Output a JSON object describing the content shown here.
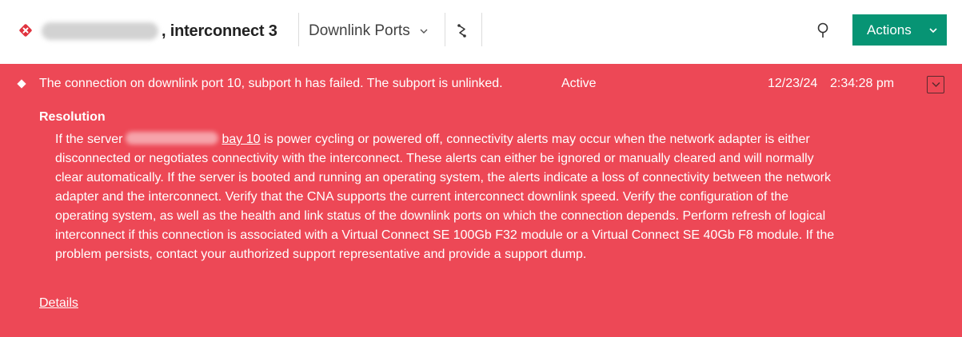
{
  "header": {
    "title": ", interconnect 3",
    "view_select_label": "Downlink Ports",
    "actions_label": "Actions",
    "status_color": "#e0323e",
    "accent_color": "#079474",
    "icons": [
      "critical-status-icon",
      "chevron-down-icon",
      "graph-icon",
      "search-icon"
    ]
  },
  "alert": {
    "message": "The connection on downlink port 10, subport h has failed. The subport is unlinked.",
    "state": "Active",
    "date": "12/23/24",
    "time": "2:34:28 pm",
    "background_color": "#ed4856",
    "resolution_heading": "Resolution",
    "resolution": {
      "prefix": "If the server",
      "bay_link": "bay 10",
      "line1_rest": "is power cycling or powered off, connectivity alerts may occur when the network adapter is either",
      "lines": [
        "disconnected or negotiates connectivity with the interconnect. These alerts can either be ignored or manually cleared and will normally",
        "clear automatically. If the server is booted and running an operating system, the alerts indicate a loss of connectivity between the network",
        "adapter and the interconnect. Verify that the CNA supports the current interconnect downlink speed. Verify the configuration of the",
        "operating system, as well as the health and link status of the downlink ports on which the connection depends. Perform refresh of logical",
        "interconnect if this connection is associated with a Virtual Connect SE 100Gb F32 module or a Virtual Connect SE 40Gb F8 module. If the",
        "problem persists, contact your authorized support representative and provide a support dump."
      ]
    },
    "details_link": "Details"
  }
}
